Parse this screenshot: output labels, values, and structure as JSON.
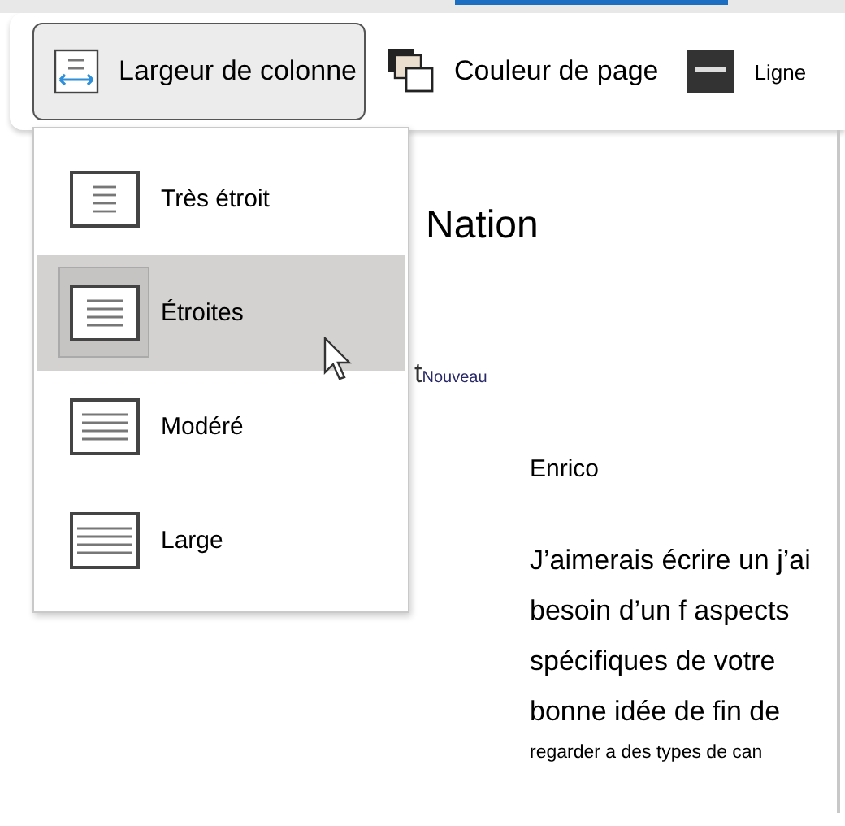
{
  "toolbar": {
    "buttons": [
      {
        "kind": "column-width",
        "label": "Largeur de colonne",
        "expanded": true
      },
      {
        "kind": "page-color",
        "label": "Couleur de page",
        "expanded": false
      },
      {
        "kind": "line",
        "label": "Ligne",
        "expanded": false
      }
    ]
  },
  "menu": {
    "items": [
      {
        "kind": "very-narrow",
        "label": "Très étroit",
        "selected": false
      },
      {
        "kind": "narrow",
        "label": "Étroites",
        "selected": true
      },
      {
        "kind": "moderate",
        "label": "Modéré",
        "selected": false
      },
      {
        "kind": "wide",
        "label": "Large",
        "selected": false
      }
    ]
  },
  "document": {
    "title": "Nation",
    "tag_letter": "t",
    "tag": "Nouveau",
    "greeting": "Enrico",
    "lines": [
      "J’aimerais écrire un j’ai",
      "besoin d’un f aspects",
      "spécifiques de votre",
      "bonne idée de fin de"
    ],
    "small_line": "regarder a des types de can"
  }
}
